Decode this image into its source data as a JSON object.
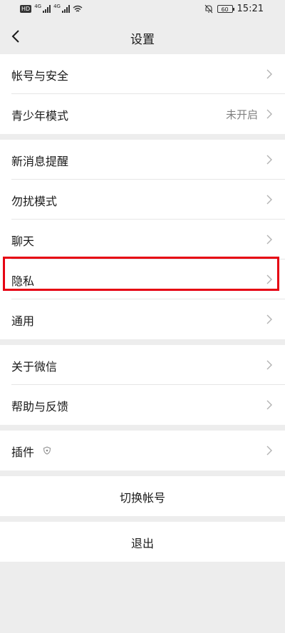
{
  "status_bar": {
    "hd_label": "HD",
    "net_tag_1": "4G",
    "net_tag_2": "4G",
    "battery": "60",
    "time": "15:21"
  },
  "header": {
    "title": "设置"
  },
  "groups": [
    {
      "items": [
        {
          "label": "帐号与安全"
        },
        {
          "label": "青少年模式",
          "value": "未开启"
        }
      ]
    },
    {
      "items": [
        {
          "label": "新消息提醒"
        },
        {
          "label": "勿扰模式"
        },
        {
          "label": "聊天"
        },
        {
          "label": "隐私"
        },
        {
          "label": "通用"
        }
      ]
    },
    {
      "items": [
        {
          "label": "关于微信"
        },
        {
          "label": "帮助与反馈"
        }
      ]
    },
    {
      "items": [
        {
          "label": "插件"
        }
      ]
    }
  ],
  "actions": {
    "switch_account": "切换帐号",
    "logout": "退出"
  },
  "highlight_color": "#e60012"
}
